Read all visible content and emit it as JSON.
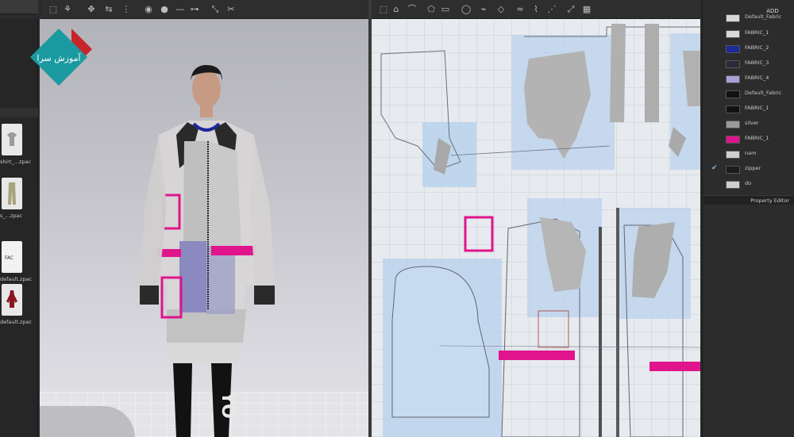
{
  "right_panel": {
    "add_label": "ADD",
    "fabrics": [
      {
        "name": "Default_Fabric",
        "swatch": "#d8d8d8",
        "selected": false
      },
      {
        "name": "FABRIC_1",
        "swatch": "#d8d8d8",
        "selected": false
      },
      {
        "name": "FABRIC_2",
        "swatch": "#1a2a9a",
        "selected": false
      },
      {
        "name": "FABRIC_3",
        "swatch": "#2a2a38",
        "selected": false
      },
      {
        "name": "FABRIC_4",
        "swatch": "#a9a0d8",
        "selected": false
      },
      {
        "name": "Default_Fabric",
        "swatch": "#111111",
        "selected": false
      },
      {
        "name": "FABRIC_1",
        "swatch": "#111111",
        "selected": false
      },
      {
        "name": "silver",
        "swatch": "#9a9a9a",
        "selected": false
      },
      {
        "name": "FABRIC_1",
        "swatch": "#e0148c",
        "selected": false
      },
      {
        "name": "nam",
        "swatch": "#cfcfcf",
        "selected": false
      },
      {
        "name": "zipper",
        "swatch": "#1c1c1c",
        "selected": true
      },
      {
        "name": "do",
        "swatch": "#cfcfcf",
        "selected": false
      }
    ],
    "property_editor_label": "Property Editor"
  },
  "library": {
    "items": [
      {
        "label": "shirt_...zpac",
        "icon": "shirt-icon"
      },
      {
        "label": "s_...zpac",
        "icon": "pants-icon"
      },
      {
        "label": "default.zpac",
        "icon": "fabric-file-icon",
        "badge": "FAC"
      },
      {
        "label": "default.zpac",
        "icon": "avatar-icon"
      }
    ]
  },
  "toolbar_left": {
    "icons": [
      "select-mesh-icon",
      "transform-icon",
      "move-icon",
      "fold-icon",
      "tack-icon",
      "pin-icon",
      "circle-pin-icon",
      "line-icon",
      "measure-icon",
      "cut-icon",
      "scissors-icon"
    ]
  },
  "toolbar_right": {
    "icons": [
      "pattern-select-icon",
      "edit-point-icon",
      "curve-icon",
      "polygon-icon",
      "rectangle-icon",
      "circle-icon",
      "trace-icon",
      "dart-icon",
      "seam-icon",
      "segment-icon",
      "stitch-icon",
      "fold-arrange-icon",
      "arrange-grid-icon"
    ]
  },
  "colors": {
    "accent_magenta": "#e0148c",
    "pattern_blue": "#b9d2ec",
    "silver": "#b8b8b8",
    "panel_dark": "#2b2b2b",
    "logo_teal": "#1a9aa0",
    "logo_red": "#c8242c"
  },
  "logo": {
    "text": "آموزش سرا",
    "icon": "brand-logo-icon"
  }
}
